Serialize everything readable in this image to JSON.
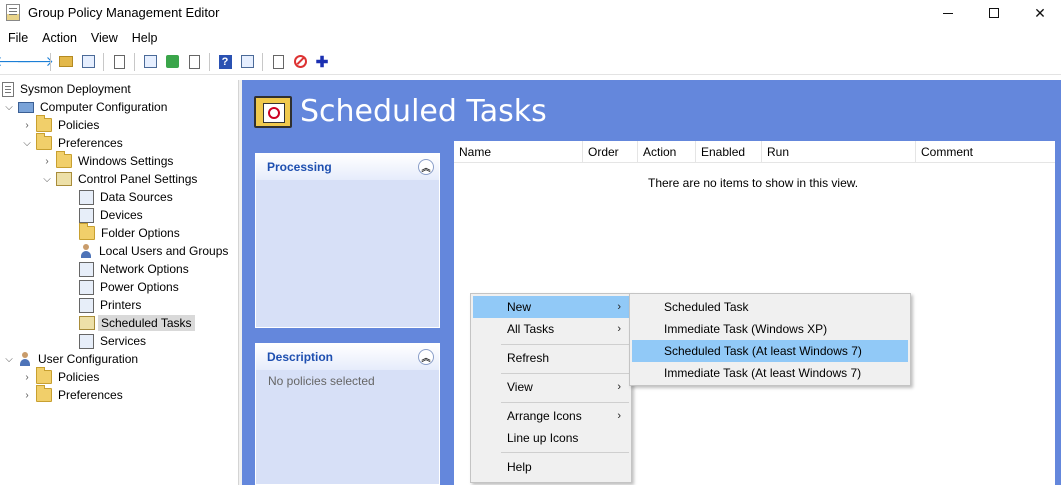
{
  "window": {
    "title": "Group Policy Management Editor"
  },
  "menubar": [
    "File",
    "Action",
    "View",
    "Help"
  ],
  "toolbar": [
    "back-icon",
    "forward-icon",
    "up-folder-icon",
    "show-hide-tree-icon",
    "properties-icon",
    "print-icon",
    "refresh-icon",
    "export-icon",
    "help-icon",
    "show-hide-action-pane-icon",
    "properties-page-icon",
    "stop-icon",
    "add-icon"
  ],
  "tree": [
    {
      "label": "Sysmon Deployment",
      "icon": "gpo-icon",
      "expander": ""
    },
    {
      "label": "Computer Configuration",
      "icon": "computer-icon",
      "expander": "expanded"
    },
    {
      "label": "Policies",
      "icon": "folder-icon",
      "expander": "collapsed"
    },
    {
      "label": "Preferences",
      "icon": "folder-icon",
      "expander": "expanded"
    },
    {
      "label": "Windows Settings",
      "icon": "folder-icon",
      "expander": "collapsed"
    },
    {
      "label": "Control Panel Settings",
      "icon": "control-panel-icon",
      "expander": "expanded"
    },
    {
      "label": "Data Sources",
      "icon": "data-sources-icon",
      "expander": ""
    },
    {
      "label": "Devices",
      "icon": "devices-icon",
      "expander": ""
    },
    {
      "label": "Folder Options",
      "icon": "folder-options-icon",
      "expander": ""
    },
    {
      "label": "Local Users and Groups",
      "icon": "users-groups-icon",
      "expander": ""
    },
    {
      "label": "Network Options",
      "icon": "network-icon",
      "expander": ""
    },
    {
      "label": "Power Options",
      "icon": "power-icon",
      "expander": ""
    },
    {
      "label": "Printers",
      "icon": "printer-icon",
      "expander": ""
    },
    {
      "label": "Scheduled Tasks",
      "icon": "scheduled-tasks-icon",
      "expander": "",
      "selected": true
    },
    {
      "label": "Services",
      "icon": "services-icon",
      "expander": ""
    },
    {
      "label": "User Configuration",
      "icon": "user-icon",
      "expander": "expanded"
    },
    {
      "label": "Policies",
      "icon": "folder-icon",
      "expander": "collapsed"
    },
    {
      "label": "Preferences",
      "icon": "folder-icon",
      "expander": "collapsed"
    }
  ],
  "content": {
    "title": "Scheduled Tasks",
    "processing": {
      "title": "Processing"
    },
    "description": {
      "title": "Description",
      "text": "No policies selected"
    },
    "columns": [
      "Name",
      "Order",
      "Action",
      "Enabled",
      "Run",
      "Comment"
    ],
    "empty_text": "There are no items to show in this view."
  },
  "context_menu": {
    "items": [
      {
        "label": "New",
        "submenu": true,
        "highlighted": true
      },
      {
        "label": "All Tasks",
        "submenu": true
      },
      {
        "label": "Refresh"
      },
      {
        "label": "View",
        "submenu": true
      },
      {
        "label": "Arrange Icons",
        "submenu": true
      },
      {
        "label": "Line up Icons"
      },
      {
        "label": "Help"
      }
    ],
    "submenu_items": [
      {
        "label": "Scheduled Task"
      },
      {
        "label": "Immediate Task (Windows XP)"
      },
      {
        "label": "Scheduled Task (At least Windows 7)",
        "highlighted": true
      },
      {
        "label": "Immediate Task (At least Windows 7)"
      }
    ]
  }
}
